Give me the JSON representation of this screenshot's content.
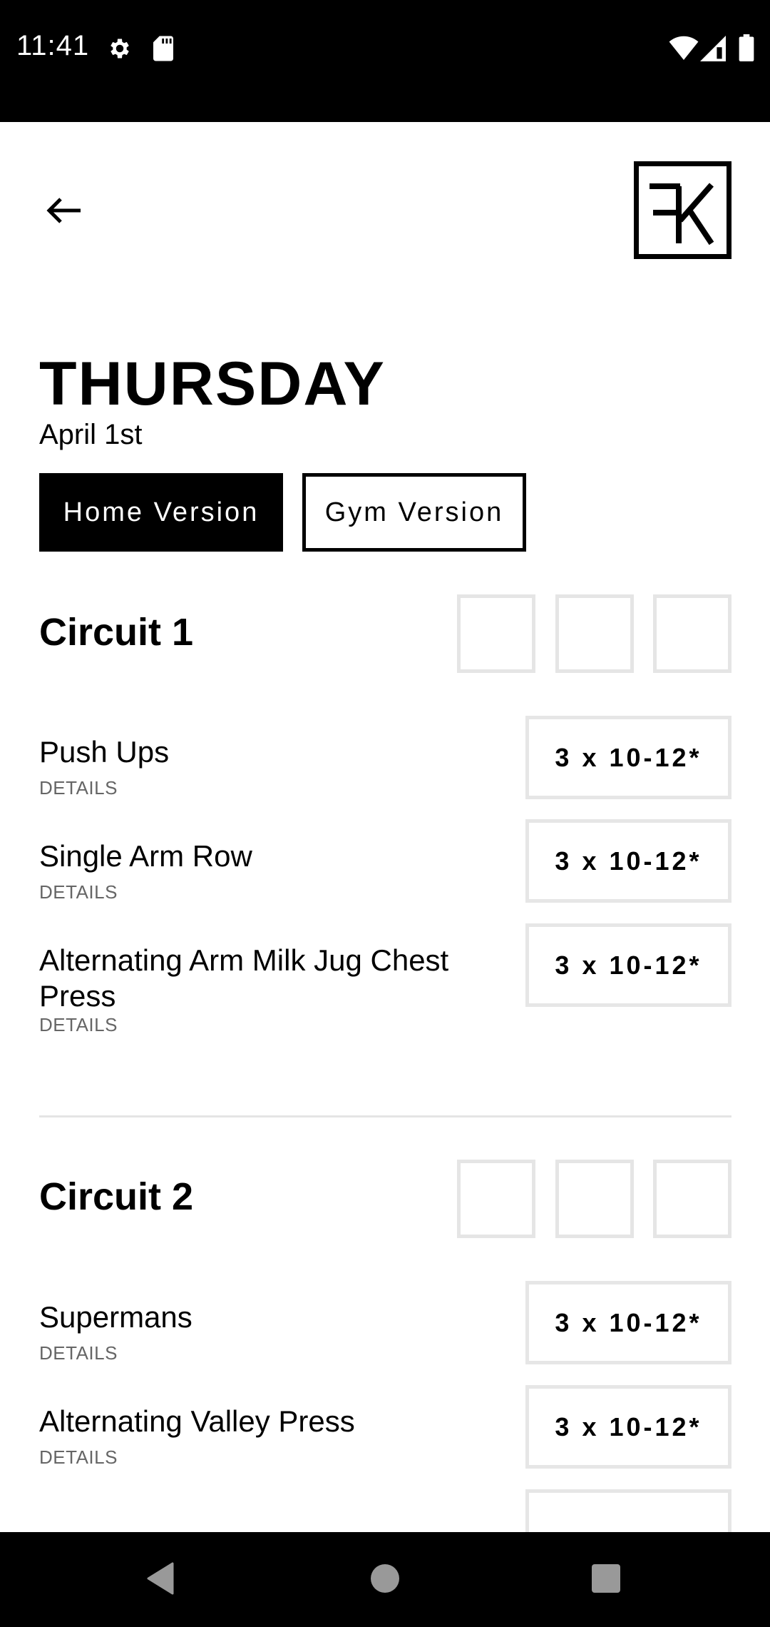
{
  "status_bar": {
    "time": "11:41",
    "icons": [
      "gear-icon",
      "sd-card-icon",
      "wifi-icon",
      "signal-icon",
      "battery-icon"
    ]
  },
  "header": {
    "back_icon": "arrow-left-icon",
    "logo_text": "FK"
  },
  "day": {
    "title": "THURSDAY",
    "date": "April 1st"
  },
  "version_toggle": {
    "options": [
      {
        "label": "Home Version",
        "selected": true
      },
      {
        "label": "Gym Version",
        "selected": false
      }
    ]
  },
  "circuits": [
    {
      "title": "Circuit 1",
      "rounds_completed": [
        false,
        false,
        false
      ],
      "exercises": [
        {
          "name": "Push Ups",
          "details_label": "DETAILS",
          "sets": "3 x 10-12*"
        },
        {
          "name": "Single Arm Row",
          "details_label": "DETAILS",
          "sets": "3 x 10-12*"
        },
        {
          "name": "Alternating Arm Milk Jug Chest Press",
          "details_label": "DETAILS",
          "sets": "3 x 10-12*"
        }
      ]
    },
    {
      "title": "Circuit 2",
      "rounds_completed": [
        false,
        false,
        false
      ],
      "exercises": [
        {
          "name": "Supermans",
          "details_label": "DETAILS",
          "sets": "3 x 10-12*"
        },
        {
          "name": "Alternating Valley Press",
          "details_label": "DETAILS",
          "sets": "3 x 10-12*"
        }
      ]
    }
  ],
  "nav_bar": {
    "buttons": [
      "back-triangle-icon",
      "home-circle-icon",
      "recents-square-icon"
    ]
  }
}
